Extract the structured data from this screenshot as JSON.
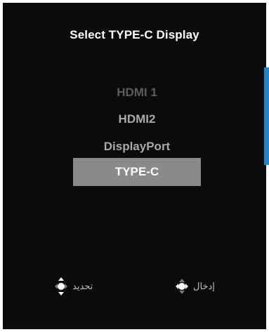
{
  "osd": {
    "title": "Select TYPE-C Display",
    "sources": [
      {
        "label": "HDMI 1",
        "state": "disabled"
      },
      {
        "label": "HDMI2",
        "state": "normal"
      },
      {
        "label": "DisplayPort",
        "state": "normal"
      },
      {
        "label": "TYPE-C",
        "state": "selected"
      }
    ],
    "hints": {
      "select_label": "تحديد",
      "select_icon": "joystick-up-down-icon",
      "enter_label": "إدخال",
      "enter_icon": "joystick-press-icon"
    }
  },
  "colors": {
    "background": "#0b0b0b",
    "accent": "#1e86c8",
    "selected_bg": "#8a8a8a"
  }
}
